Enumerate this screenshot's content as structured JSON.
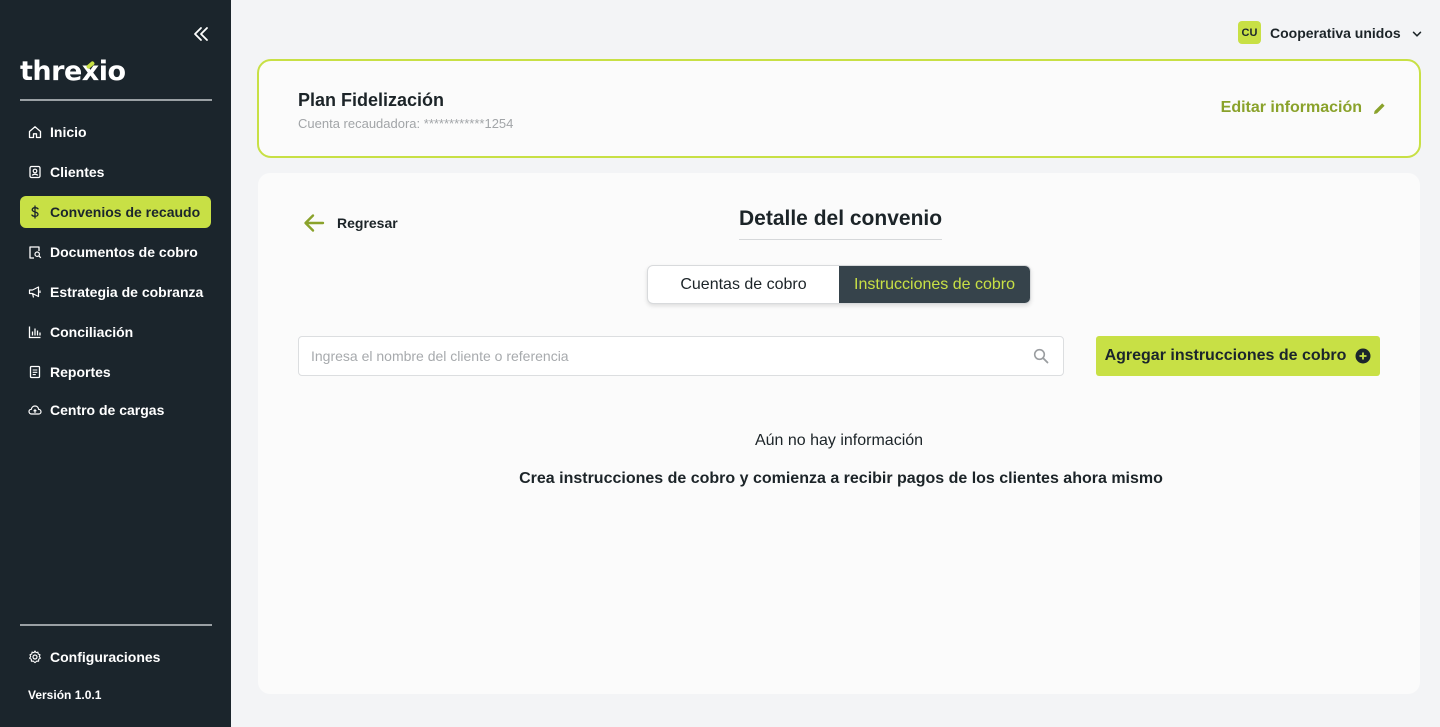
{
  "sidebar": {
    "logo": "threxio",
    "items": [
      {
        "label": "Inicio",
        "icon": "home-icon"
      },
      {
        "label": "Clientes",
        "icon": "contact-icon"
      },
      {
        "label": "Convenios de recaudo",
        "icon": "dollar-icon",
        "active": true
      },
      {
        "label": "Documentos de cobro",
        "icon": "document-search-icon"
      },
      {
        "label": "Estrategia de cobranza",
        "icon": "megaphone-icon"
      },
      {
        "label": "Conciliación",
        "icon": "bar-chart-icon"
      },
      {
        "label": "Reportes",
        "icon": "report-icon"
      },
      {
        "label": "Centro de cargas",
        "icon": "cloud-upload-icon"
      }
    ],
    "settings_label": "Configuraciones",
    "version": "Versión 1.0.1"
  },
  "user": {
    "initials": "CU",
    "name": "Cooperativa unidos"
  },
  "plan": {
    "title": "Plan Fidelización",
    "account": "Cuenta recaudadora: ************1254",
    "edit_label": "Editar información"
  },
  "main": {
    "back_label": "Regresar",
    "title": "Detalle del convenio",
    "tabs": [
      {
        "label": "Cuentas de cobro",
        "active": false
      },
      {
        "label": "Instrucciones de cobro",
        "active": true
      }
    ],
    "search": {
      "placeholder": "Ingresa el nombre del cliente o referencia",
      "value": ""
    },
    "add_button": "Agregar instrucciones de cobro",
    "empty_title": "Aún no hay información",
    "empty_message": "Crea instrucciones de cobro y comienza a recibir pagos de los clientes ahora mismo"
  },
  "colors": {
    "accent": "#c8e045",
    "sidebar_bg": "#1b252c",
    "active_tab_bg": "#36434b",
    "edit_link": "#8aa22b"
  }
}
